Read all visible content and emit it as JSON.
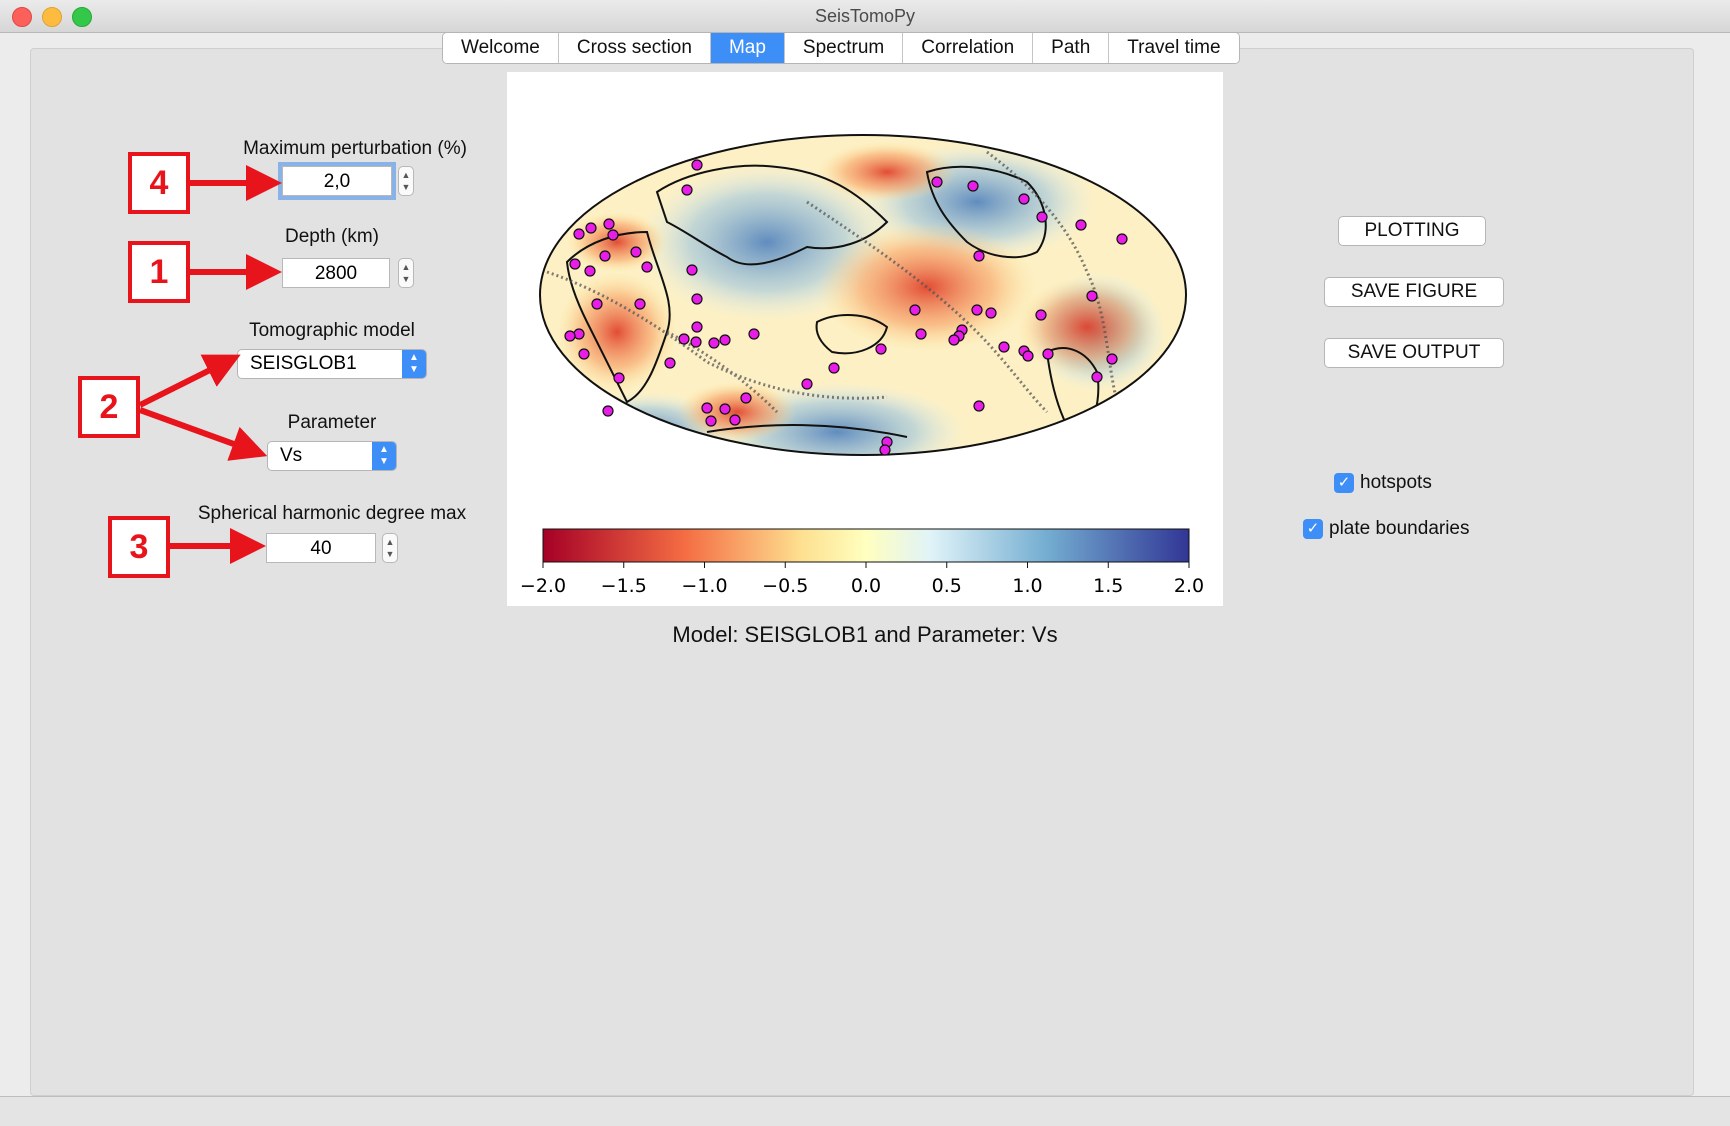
{
  "window": {
    "title": "SeisTomoPy"
  },
  "tabs": [
    {
      "label": "Welcome",
      "active": false
    },
    {
      "label": "Cross section",
      "active": false
    },
    {
      "label": "Map",
      "active": true
    },
    {
      "label": "Spectrum",
      "active": false
    },
    {
      "label": "Correlation",
      "active": false
    },
    {
      "label": "Path",
      "active": false
    },
    {
      "label": "Travel time",
      "active": false
    }
  ],
  "controls": {
    "max_perturbation": {
      "label": "Maximum perturbation (%)",
      "value": "2,0"
    },
    "depth": {
      "label": "Depth (km)",
      "value": "2800"
    },
    "model": {
      "label": "Tomographic model",
      "value": "SEISGLOB1"
    },
    "parameter": {
      "label": "Parameter",
      "value": "Vs"
    },
    "sh_degree": {
      "label": "Spherical harmonic degree max",
      "value": "40"
    }
  },
  "callouts": {
    "depth": "1",
    "model_param": "2",
    "sh_degree": "3",
    "perturbation": "4"
  },
  "buttons": {
    "plotting": "PLOTTING",
    "save_figure": "SAVE FIGURE",
    "save_output": "SAVE OUTPUT"
  },
  "checkboxes": {
    "hotspots": "hotspots",
    "plate_boundaries": "plate boundaries",
    "hotspots_checked": true,
    "plate_boundaries_checked": true
  },
  "figure": {
    "caption": "Model: SEISGLOB1 and Parameter: Vs",
    "colorbar_ticks": [
      "−2.0",
      "−1.5",
      "−1.0",
      "−0.5",
      "0.0",
      "0.5",
      "1.0",
      "1.5",
      "2.0"
    ],
    "colorbar_range": [
      -2.0,
      2.0
    ],
    "colormap": [
      "#a50026",
      "#f46d43",
      "#fee090",
      "#ffffbf",
      "#e0f3f8",
      "#74add1",
      "#313695"
    ],
    "hotspot_color": "#e81ee8"
  },
  "colors": {
    "accent": "#3d8ef7",
    "callout": "#e8141b"
  }
}
